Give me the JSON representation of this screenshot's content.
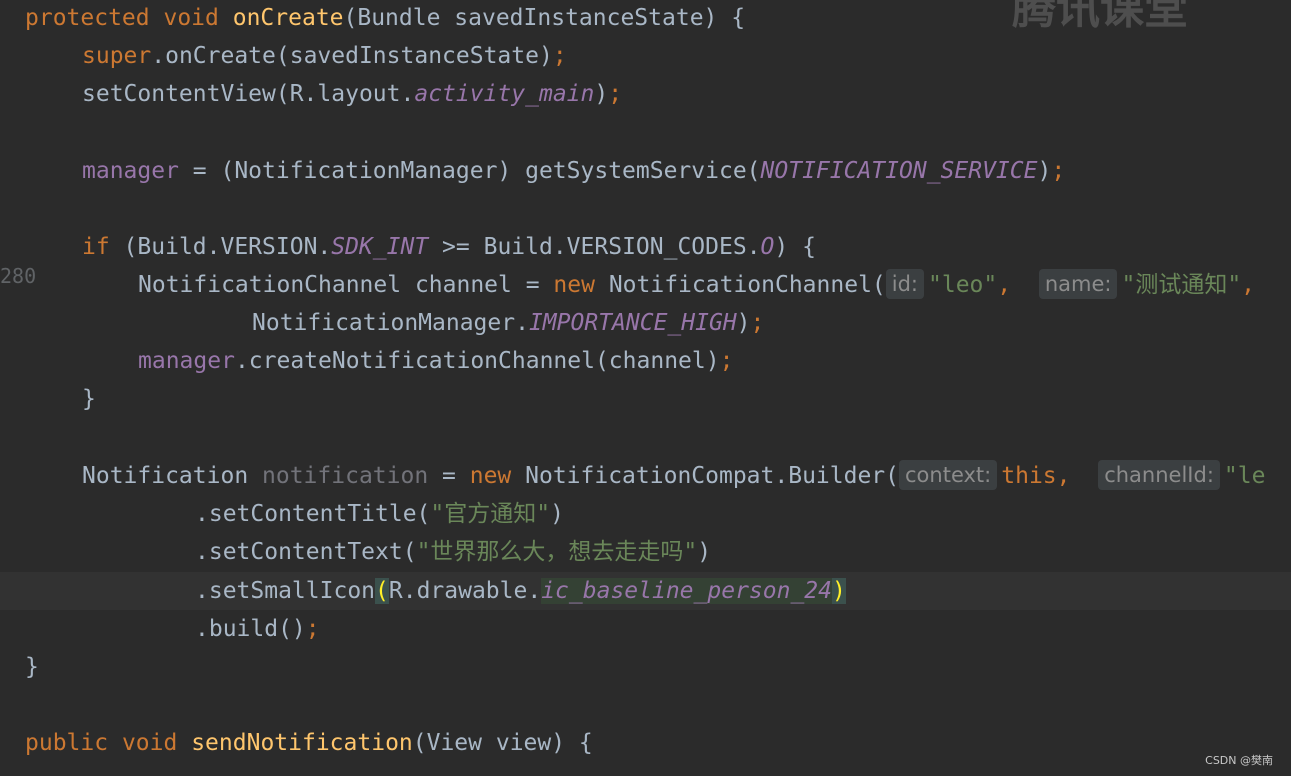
{
  "editor": {
    "gutter_number": "280",
    "lines": {
      "l1": {
        "kw1": "protected",
        "kw2": "void",
        "method": "onCreate",
        "rest": "(Bundle savedInstanceState) {"
      },
      "l2": {
        "kw": "super",
        "rest": ".onCreate(savedInstanceState)",
        "semi": ";"
      },
      "l3": {
        "pre": "setContentView(R.layout.",
        "static": "activity_main",
        "post": ")",
        "semi": ";"
      },
      "l4": {
        "field": "manager",
        "mid": " = (NotificationManager) getSystemService(",
        "static": "NOTIFICATION_SERVICE",
        "post": ")",
        "semi": ";"
      },
      "l5": {
        "kw": "if",
        "pre": " (Build.VERSION.",
        "static1": "SDK_INT",
        "mid": " >= Build.VERSION_CODES.",
        "static2": "O",
        "post": ") {"
      },
      "l6": {
        "pre": "NotificationChannel channel = ",
        "kw": "new",
        "mid": " NotificationChannel(",
        "hint1": "id:",
        "str1": "\"leo\"",
        "comma1": ",",
        "hint2": "name:",
        "str2": "\"测试通知\"",
        "comma2": ","
      },
      "l7": {
        "pre": "NotificationManager.",
        "static": "IMPORTANCE_HIGH",
        "post": ")",
        "semi": ";"
      },
      "l8": {
        "field": "manager",
        "rest": ".createNotificationChannel(channel)",
        "semi": ";"
      },
      "l9": {
        "text": "}"
      },
      "l10": {
        "pre": "Notification ",
        "unused": "notification",
        "mid": " = ",
        "kw": "new",
        "mid2": " NotificationCompat.Builder(",
        "hint1": "context:",
        "kw2": "this",
        "comma1": ",",
        "hint2": "channelId:",
        "str": "\"le"
      },
      "l11": {
        "pre": ".setContentTitle(",
        "str": "\"官方通知\"",
        "post": ")"
      },
      "l12": {
        "pre": ".setContentText(",
        "str": "\"世界那么大，想去走走吗\"",
        "post": ")"
      },
      "l13": {
        "pre": ".setSmallIcon",
        "open": "(",
        "mid": "R.drawable.",
        "static": "ic_baseline_person_24",
        "close": ")"
      },
      "l14": {
        "pre": ".build()",
        "semi": ";"
      },
      "l15": {
        "text": "}"
      },
      "l16": {
        "kw1": "public",
        "kw2": "void",
        "method": "sendNotification",
        "rest": "(View view) {"
      }
    }
  },
  "watermark": "腾讯课堂",
  "footer": {
    "credit": "CSDN @樊南"
  },
  "colors": {
    "background": "#2b2b2b",
    "keyword": "#cc7832",
    "method": "#ffc66d",
    "field": "#9876aa",
    "string": "#6a8759",
    "default": "#a9b7c6"
  }
}
